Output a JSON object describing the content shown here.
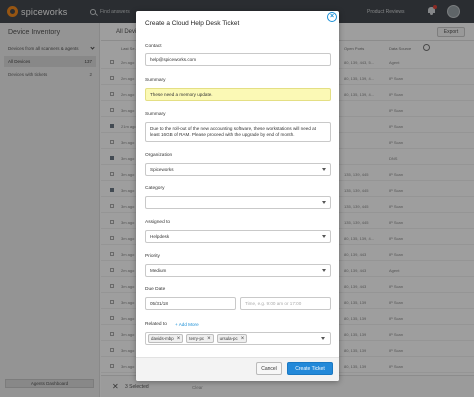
{
  "topbar": {
    "logo_text": "spiceworks",
    "search_text": "Find answers",
    "product_reviews": "Product Reviews"
  },
  "sidebar": {
    "title": "Device Inventory",
    "filter_label": "Devices from all scanners & agents",
    "items": [
      {
        "label": "All Devices",
        "count": "137"
      },
      {
        "label": "Devices with tickets",
        "count": "2"
      }
    ],
    "agents_button": "Agents Dashboard"
  },
  "main": {
    "title": "All Devices",
    "export_label": "Export",
    "columns": {
      "last": "Last Se...",
      "ports": "Open Ports",
      "source": "Data Source"
    },
    "rows": [
      {
        "checked": false,
        "date": "2m ago",
        "ports": "80, 139, 443, 5...",
        "source": "Agent"
      },
      {
        "checked": false,
        "date": "2m ago",
        "ports": "80, 135, 139, 4...",
        "source": "IP Scan"
      },
      {
        "checked": false,
        "date": "2m ago",
        "ports": "80, 135, 139, 4...",
        "source": "IP Scan"
      },
      {
        "checked": false,
        "date": "3m ago",
        "ports": "",
        "source": "IP Scan"
      },
      {
        "checked": true,
        "date": "21m ago",
        "ports": "",
        "source": "IP Scan"
      },
      {
        "checked": false,
        "date": "3m ago",
        "ports": "",
        "source": "IP Scan"
      },
      {
        "checked": true,
        "date": "3m ago",
        "ports": "",
        "source": "DNS"
      },
      {
        "checked": false,
        "date": "3m ago",
        "ports": "135, 139, 445",
        "source": "IP Scan"
      },
      {
        "checked": true,
        "date": "3m ago",
        "ports": "135, 139, 445",
        "source": "IP Scan"
      },
      {
        "checked": false,
        "date": "3m ago",
        "ports": "135, 139, 445",
        "source": "IP Scan"
      },
      {
        "checked": false,
        "date": "3m ago",
        "ports": "135, 139, 445",
        "source": "IP Scan"
      },
      {
        "checked": false,
        "date": "3m ago",
        "ports": "80, 135, 139, 4...",
        "source": "IP Scan"
      },
      {
        "checked": false,
        "date": "3m ago",
        "ports": "80, 139, 443",
        "source": "IP Scan"
      },
      {
        "checked": false,
        "date": "2m ago",
        "ports": "80, 139, 443",
        "source": "Agent"
      },
      {
        "checked": false,
        "date": "3m ago",
        "ports": "80, 139, 443",
        "source": "IP Scan"
      },
      {
        "checked": false,
        "date": "3m ago",
        "ports": "80, 135, 139",
        "source": "IP Scan"
      },
      {
        "checked": false,
        "date": "3m ago",
        "ports": "80, 135, 139",
        "source": "IP Scan"
      },
      {
        "checked": false,
        "date": "3m ago",
        "ports": "80, 135, 139",
        "source": "IP Scan"
      },
      {
        "checked": false,
        "date": "3m ago",
        "ports": "80, 135, 139",
        "source": "IP Scan"
      },
      {
        "checked": false,
        "date": "3m ago",
        "ports": "80, 135, 139",
        "source": "IP Scan"
      }
    ],
    "bottom_selected": "3 Selected",
    "bottom_link": "Clear"
  },
  "modal": {
    "title": "Create a Cloud Help Desk Ticket",
    "contact_label": "Contact",
    "contact_value": "help@spiceworks.com",
    "summary_label": "Summary",
    "summary_value": "These need a memory update.",
    "summary2_label": "Summary",
    "summary2_value": "Due to the roll-out of the new accounting software, these workstations will need at least 16GB of RAM. Please proceed with the upgrade by end of month.",
    "organization_label": "Organization",
    "organization_value": "Spiceworks",
    "category_label": "Category",
    "category_value": "",
    "assigned_label": "Assigned to",
    "assigned_value": "Helpdesk",
    "priority_label": "Priority",
    "priority_value": "Medium",
    "due_label": "Due Date",
    "due_date": "05/31/18",
    "due_time_placeholder": "Time, e.g. 9:00 am or 17:00",
    "related_label": "Related to",
    "add_more": "+ Add More",
    "tags": [
      "davids-mbp",
      "terry-pc",
      "ursula-pc"
    ],
    "cancel_label": "Cancel",
    "create_label": "Create Ticket"
  }
}
